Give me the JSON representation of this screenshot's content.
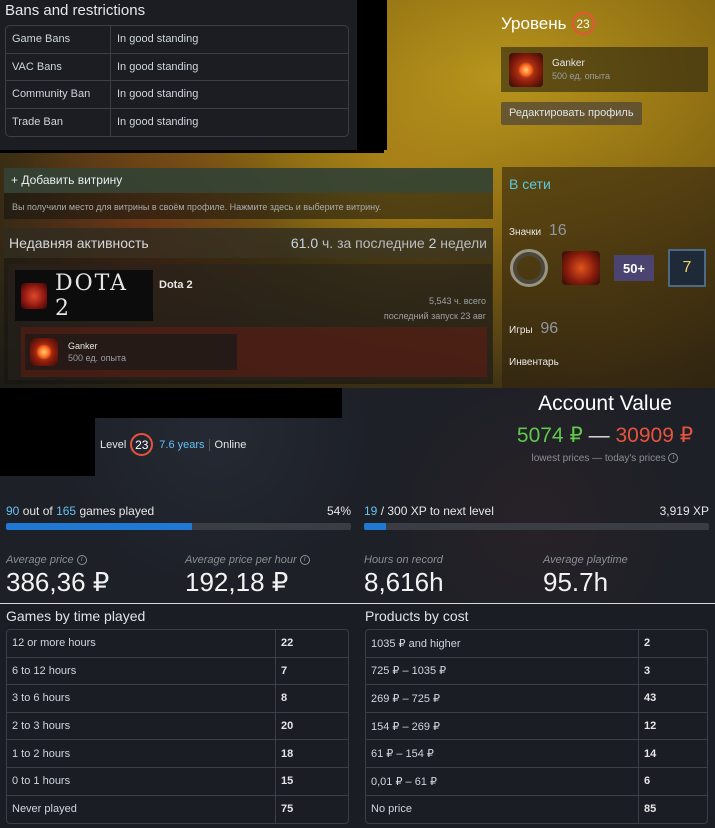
{
  "bans": {
    "title": "Bans and restrictions",
    "rows": [
      {
        "label": "Game Bans",
        "value": "In good standing"
      },
      {
        "label": "VAC Bans",
        "value": "In good standing"
      },
      {
        "label": "Community Ban",
        "value": "In good standing"
      },
      {
        "label": "Trade Ban",
        "value": "In good standing"
      }
    ]
  },
  "profile": {
    "level_label": "Уровень",
    "level": "23",
    "badge_name": "Ganker",
    "badge_xp": "500 ед. опыта",
    "edit_button": "Редактировать профиль",
    "showcase_title": "+ Добавить витрину",
    "showcase_desc": "Вы получили место для витрины в своём профиле. Нажмите здесь и выберите витрину.",
    "activity_title": "Недавняя активность",
    "activity_hours": "61.0",
    "activity_hours_unit": "ч. за последние",
    "activity_weeks": "2",
    "activity_weeks_unit": "недели",
    "game_logo_text": "DOTA 2",
    "game_name": "Dota 2",
    "game_total": "5,543 ч. всего",
    "game_last": "последний запуск 23 авг",
    "game_badge_name": "Ganker",
    "game_badge_xp": "500 ед. опыта",
    "status": "В сети",
    "badges_label": "Значки",
    "badges_count": "16",
    "badge_50_text": "50+",
    "badge_7_text": "7",
    "games_label": "Игры",
    "games_count": "96",
    "inventory_label": "Инвентарь"
  },
  "summary": {
    "level_label": "Level",
    "level": "23",
    "years": "7.6 years",
    "online": "Online",
    "account_title": "Account Value",
    "value_low": "5074 ₽",
    "value_sep": "—",
    "value_high": "30909 ₽",
    "value_sub": "lowest prices — today's prices",
    "info_glyph": "i",
    "games_played_count": "90",
    "games_played_mid": "out of",
    "games_total": "165",
    "games_played_tail": "games played",
    "games_played_pct": "54%",
    "games_played_fraction": 0.54,
    "xp_current": "19",
    "xp_tail": "/ 300 XP to next level",
    "xp_total": "3,919 XP",
    "xp_fraction": 0.063,
    "stats": [
      {
        "label": "Average price",
        "value": "386,36 ₽",
        "info": true
      },
      {
        "label": "Average price per hour",
        "value": "192,18 ₽",
        "info": true
      },
      {
        "label": "Hours on record",
        "value": "8,616h",
        "info": false
      },
      {
        "label": "Average playtime",
        "value": "95.7h",
        "info": false
      }
    ]
  },
  "games_by_time": {
    "title": "Games by time played",
    "rows": [
      {
        "label": "12 or more hours",
        "value": "22"
      },
      {
        "label": "6 to 12 hours",
        "value": "7"
      },
      {
        "label": "3 to 6 hours",
        "value": "8"
      },
      {
        "label": "2 to 3 hours",
        "value": "20"
      },
      {
        "label": "1 to 2 hours",
        "value": "18"
      },
      {
        "label": "0 to 1 hours",
        "value": "15"
      },
      {
        "label": "Never played",
        "value": "75"
      }
    ]
  },
  "products_by_cost": {
    "title": "Products by cost",
    "rows": [
      {
        "label": "1035 ₽ and higher",
        "value": "2"
      },
      {
        "label": "725 ₽ – 1035 ₽",
        "value": "3"
      },
      {
        "label": "269 ₽ – 725 ₽",
        "value": "43"
      },
      {
        "label": "154 ₽ – 269 ₽",
        "value": "12"
      },
      {
        "label": "61 ₽ – 154 ₽",
        "value": "14"
      },
      {
        "label": "0,01 ₽ – 61 ₽",
        "value": "6"
      },
      {
        "label": "No price",
        "value": "85"
      }
    ]
  },
  "colors": {
    "accent_blue": "#66c0f4",
    "progress_blue": "#1f78d1",
    "online_cyan": "#57cbde",
    "value_green": "#5ec84a",
    "value_red": "#e8533e"
  },
  "icons": {
    "info": "info-icon",
    "badge": "dota-badge-icon"
  }
}
